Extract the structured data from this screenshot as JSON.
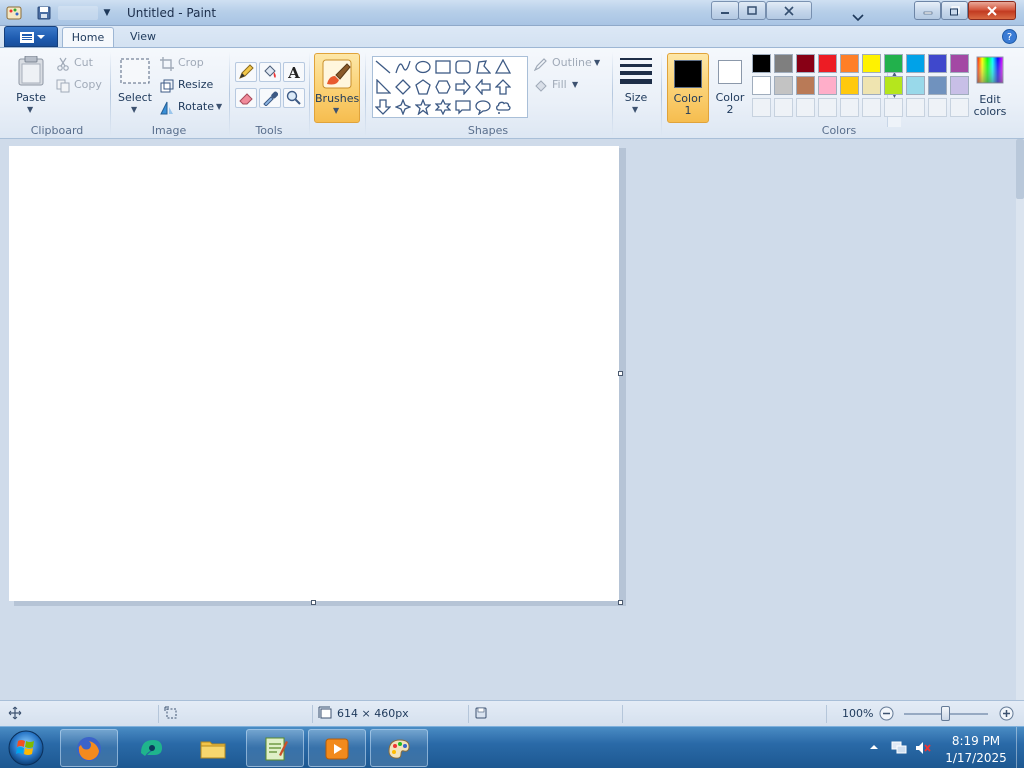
{
  "window": {
    "title": "Untitled - Paint"
  },
  "ribbon": {
    "tabs": [
      {
        "label": "Home",
        "active": true
      },
      {
        "label": "View",
        "active": false
      }
    ],
    "groups": {
      "clipboard": {
        "label": "Clipboard",
        "paste": "Paste",
        "cut": "Cut",
        "copy": "Copy"
      },
      "image": {
        "label": "Image",
        "select": "Select",
        "crop": "Crop",
        "resize": "Resize",
        "rotate": "Rotate"
      },
      "tools": {
        "label": "Tools",
        "items": [
          "pencil-icon",
          "fill-bucket-icon",
          "text-icon",
          "eraser-icon",
          "color-picker-icon",
          "magnifier-icon"
        ]
      },
      "brushes": {
        "label": "Brushes"
      },
      "shapes": {
        "label": "Shapes",
        "outline": "Outline",
        "fill": "Fill"
      },
      "size": {
        "label": "Size"
      },
      "colors": {
        "label": "Colors",
        "color1_label": "Color",
        "color1_num": "1",
        "color2_label": "Color",
        "color2_num": "2",
        "edit_colors_line1": "Edit",
        "edit_colors_line2": "colors",
        "color1_value": "#000000",
        "color2_value": "#ffffff",
        "palette_row1": [
          "#000000",
          "#7f7f7f",
          "#880015",
          "#ed1c24",
          "#ff7f27",
          "#fff200",
          "#22b14c",
          "#00a2e8",
          "#3f48cc",
          "#a349a4"
        ],
        "palette_row2": [
          "#ffffff",
          "#c3c3c3",
          "#b97a57",
          "#ffaec9",
          "#ffc90e",
          "#efe4b0",
          "#b5e61d",
          "#99d9ea",
          "#7092be",
          "#c8bfe7"
        ]
      }
    }
  },
  "statusbar": {
    "canvas_size": "614 × 460px",
    "zoom": "100%"
  },
  "taskbar": {
    "apps": [
      "firefox-icon",
      "browser-icon",
      "file-explorer-icon",
      "notepad-plus-icon",
      "media-player-icon",
      "paint-icon"
    ],
    "time": "8:19 PM",
    "date": "1/17/2025"
  }
}
